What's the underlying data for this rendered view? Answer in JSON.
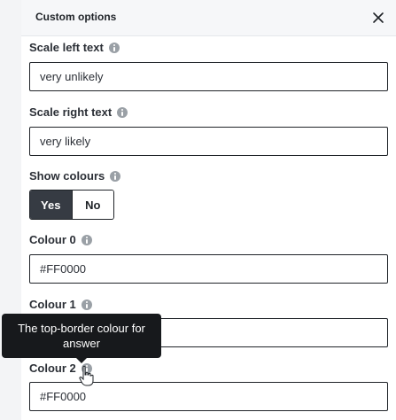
{
  "header": {
    "title": "Custom options"
  },
  "fields": {
    "scale_left": {
      "label": "Scale left text",
      "value": "very unlikely"
    },
    "scale_right": {
      "label": "Scale right text",
      "value": "very likely"
    },
    "show_colours": {
      "label": "Show colours",
      "options": [
        "Yes",
        "No"
      ],
      "selected": "Yes"
    },
    "colour0": {
      "label": "Colour 0",
      "value": "#FF0000"
    },
    "colour1": {
      "label": "Colour 1",
      "value": ""
    },
    "colour2": {
      "label": "Colour 2",
      "value": "#FF0000"
    }
  },
  "tooltip": {
    "text": "The top-border colour for answer"
  },
  "icons": {
    "close": "close-icon",
    "info": "info-icon",
    "cursor": "hand-pointer-icon"
  },
  "colors": {
    "header_bg": "#f6f7f9",
    "toggle_selected_bg": "#363b43",
    "tooltip_bg": "#17191c",
    "info_icon": "#9aa0a6"
  }
}
